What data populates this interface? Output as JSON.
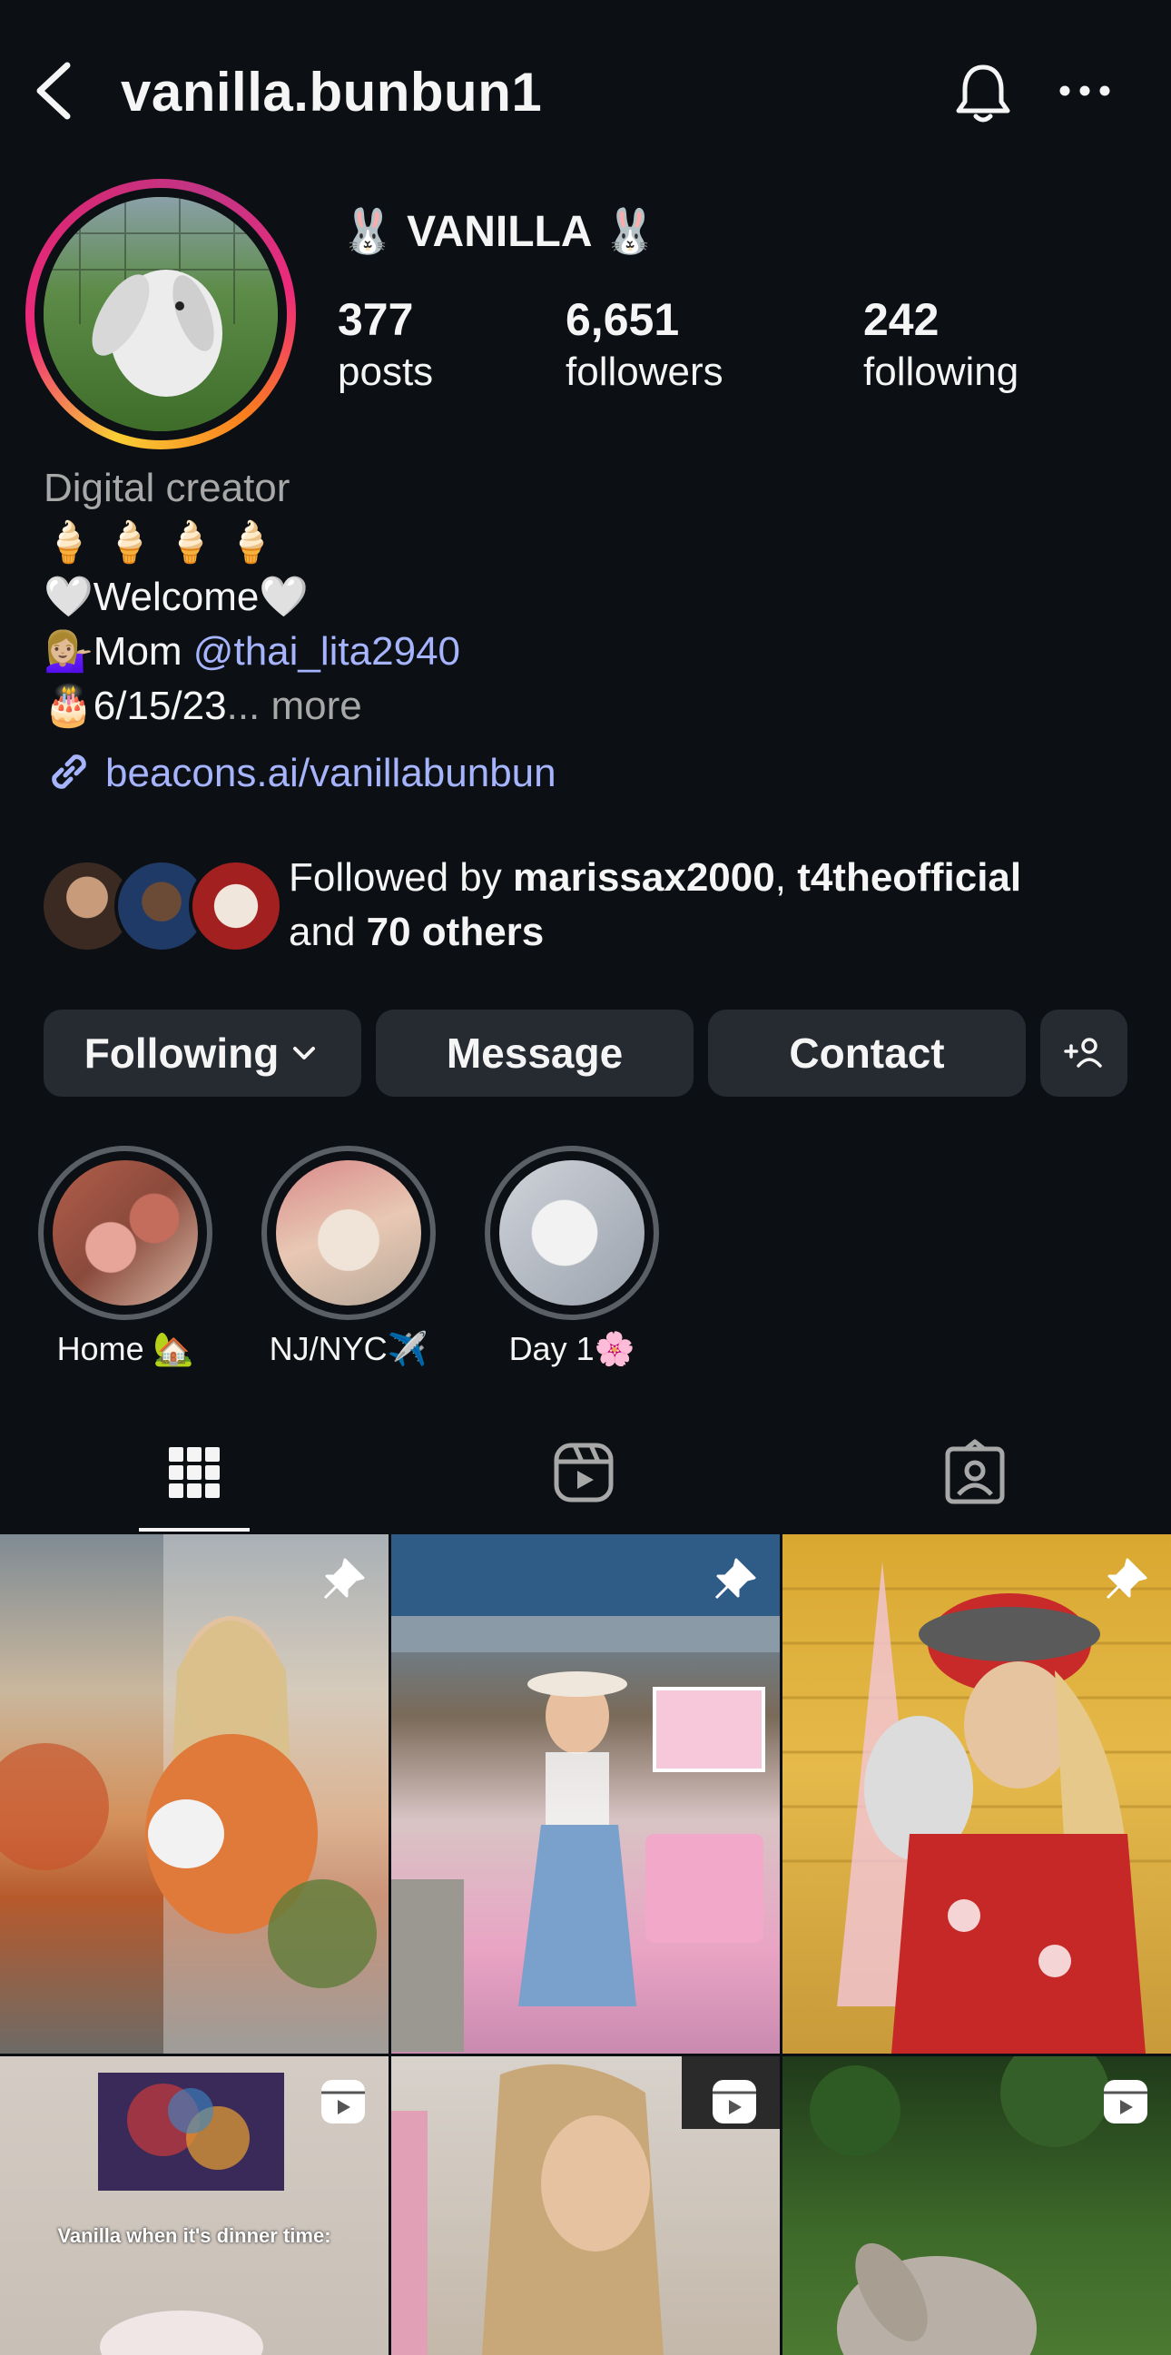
{
  "header": {
    "username": "vanilla.bunbun1",
    "back_icon": "chevron-left-icon",
    "bell_icon": "bell-icon",
    "more_icon": "more-horizontal-icon"
  },
  "profile": {
    "display_name": "🐰 VANILLA 🐰",
    "stats": [
      {
        "value": "377",
        "label": "posts"
      },
      {
        "value": "6,651",
        "label": "followers"
      },
      {
        "value": "242",
        "label": "following"
      }
    ]
  },
  "bio": {
    "category": "Digital creator",
    "line1": "🍦 🍦 🍦 🍦",
    "line2": "🤍Welcome🤍",
    "line3_prefix": "💁🏼‍♀️Mom ",
    "line3_mention": "@thai_lita2940",
    "line4": "🎂6/15/23",
    "line4_more": "... more",
    "link": "beacons.ai/vanillabunbun"
  },
  "followed_by": {
    "prefix": "Followed by ",
    "user1": "marissax2000",
    "sep": ", ",
    "user2": "t4theofficial",
    "and": "and ",
    "others": "70 others"
  },
  "actions": {
    "following": "Following",
    "message": "Message",
    "contact": "Contact"
  },
  "highlights": [
    {
      "label": "Home 🏡"
    },
    {
      "label": "NJ/NYC✈️"
    },
    {
      "label": "Day 1🌸"
    }
  ],
  "tabs": [
    "grid-icon",
    "reels-icon",
    "tagged-icon"
  ],
  "grid": {
    "overlay_text": "Vanilla when it's dinner time:"
  },
  "colors": {
    "background": "#0c1014",
    "button": "#262a31",
    "link": "#a5b4fc",
    "muted": "#a8a8a8"
  }
}
